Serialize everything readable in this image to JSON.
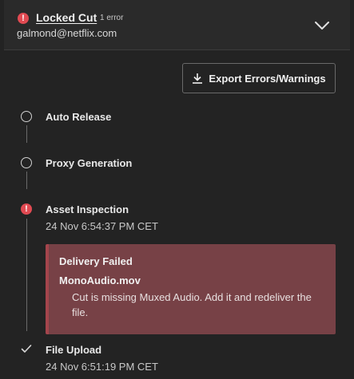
{
  "header": {
    "title": "Locked Cut",
    "error_count": "1 error",
    "email": "galmond@netflix.com"
  },
  "toolbar": {
    "export_label": "Export Errors/Warnings"
  },
  "steps": [
    {
      "label": "Auto Release",
      "status": "pending"
    },
    {
      "label": "Proxy Generation",
      "status": "pending"
    },
    {
      "label": "Asset Inspection",
      "status": "error",
      "time": "24 Nov 6:54:37 PM CET"
    },
    {
      "label": "File Upload",
      "status": "complete",
      "time": "24 Nov 6:51:19 PM CET"
    }
  ],
  "error": {
    "title": "Delivery Failed",
    "file": "MonoAudio.mov",
    "message": "Cut is missing Muxed Audio. Add it and redeliver the file."
  },
  "colors": {
    "error": "#e14a52",
    "error_box_bg": "#774146",
    "background": "#232323"
  },
  "icons": {
    "header_status": "error-icon",
    "collapse": "chevron-down-icon",
    "export": "download-icon",
    "complete": "check-icon"
  }
}
